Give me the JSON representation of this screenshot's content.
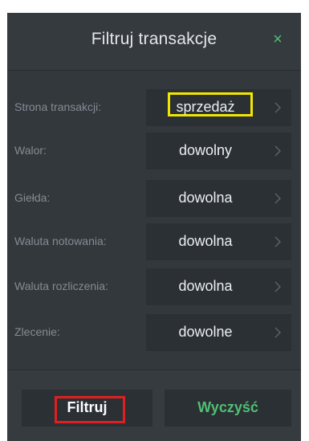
{
  "dialog": {
    "title": "Filtruj transakcje",
    "close_icon": "close-icon"
  },
  "filters": [
    {
      "label": "Strona transakcji:",
      "value": "sprzedaż",
      "highlight": "yellow"
    },
    {
      "label": "Walor:",
      "value": "dowolny"
    },
    {
      "label": "Giełda:",
      "value": "dowolna"
    },
    {
      "label": "Waluta notowania:",
      "value": "dowolna"
    },
    {
      "label": "Waluta rozliczenia:",
      "value": "dowolna"
    },
    {
      "label": "Zlecenie:",
      "value": "dowolne"
    }
  ],
  "footer": {
    "filter_label": "Filtruj",
    "clear_label": "Wyczyść",
    "filter_highlight": "red"
  },
  "colors": {
    "accent": "#4fbf72",
    "panel_bg": "#33383d",
    "field_bg": "#2b3035",
    "label_text": "#848b92",
    "highlight_yellow": "#f2e600",
    "highlight_red": "#e02020"
  }
}
